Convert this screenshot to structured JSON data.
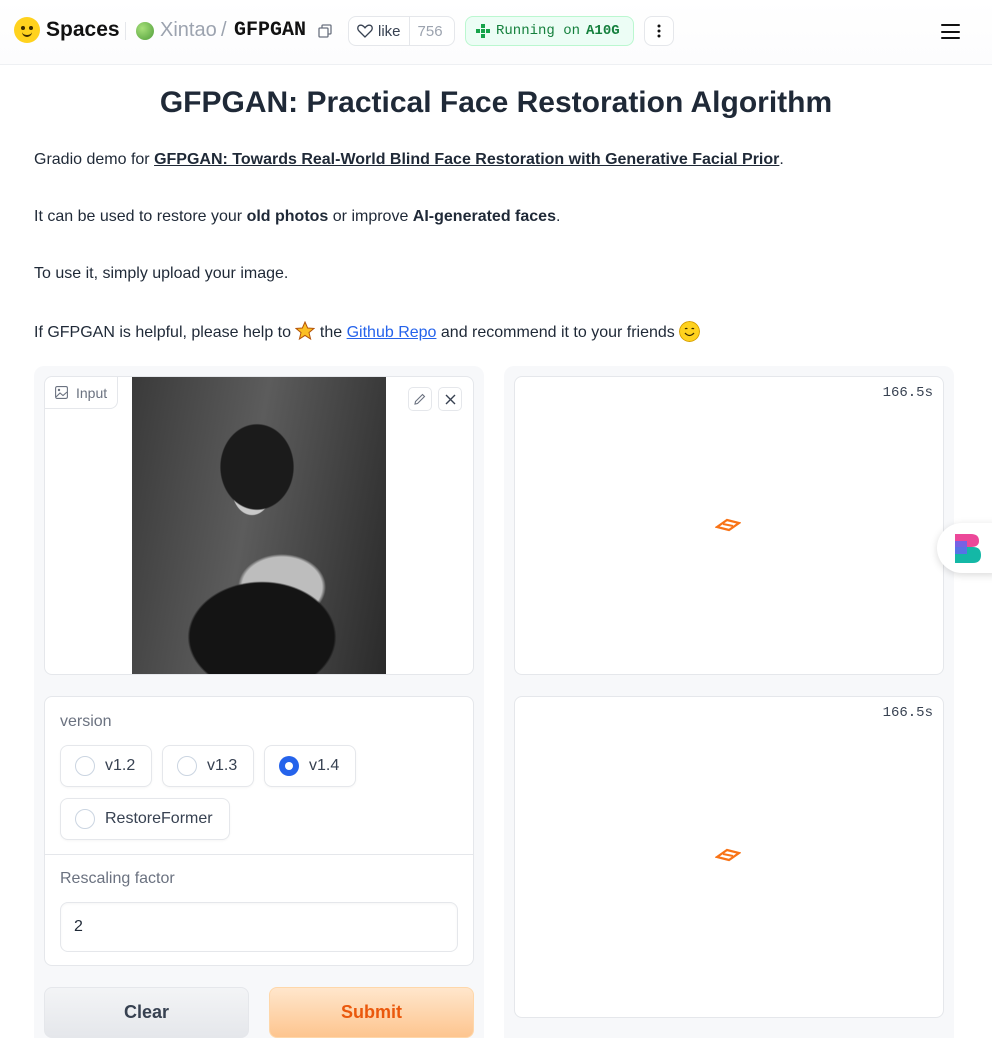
{
  "header": {
    "brand": "Spaces",
    "org": "Xintao",
    "separator": "/",
    "repo": "GFPGAN",
    "like_label": "like",
    "like_count": "756",
    "status_prefix": "Running on",
    "status_hardware": "A10G"
  },
  "main": {
    "title": "GFPGAN: Practical Face Restoration Algorithm",
    "intro_prefix": "Gradio demo for ",
    "intro_link": "GFPGAN: Towards Real-World Blind Face Restoration with Generative Facial Prior",
    "intro_suffix": ".",
    "use_prefix": "It can be used to restore your ",
    "use_bold1": "old photos",
    "use_mid": " or improve ",
    "use_bold2": "AI-generated faces",
    "use_suffix": ".",
    "upload_text": "To use it, simply upload your image.",
    "help_prefix": "If GFPGAN is helpful, please help to ",
    "help_mid": " the ",
    "help_link": "Github Repo",
    "help_suffix": " and recommend it to your friends "
  },
  "input": {
    "label": "Input",
    "version_label": "version",
    "version_options": [
      "v1.2",
      "v1.3",
      "v1.4",
      "RestoreFormer"
    ],
    "version_selected": "v1.4",
    "rescale_label": "Rescaling factor",
    "rescale_value": "2"
  },
  "actions": {
    "clear": "Clear",
    "submit": "Submit"
  },
  "output": {
    "timer1": "166.5s",
    "timer2": "166.5s"
  },
  "colors": {
    "accent": "#2563eb",
    "submit_text": "#ea580c",
    "loader": "#f97316",
    "running_green": "#15803d"
  }
}
